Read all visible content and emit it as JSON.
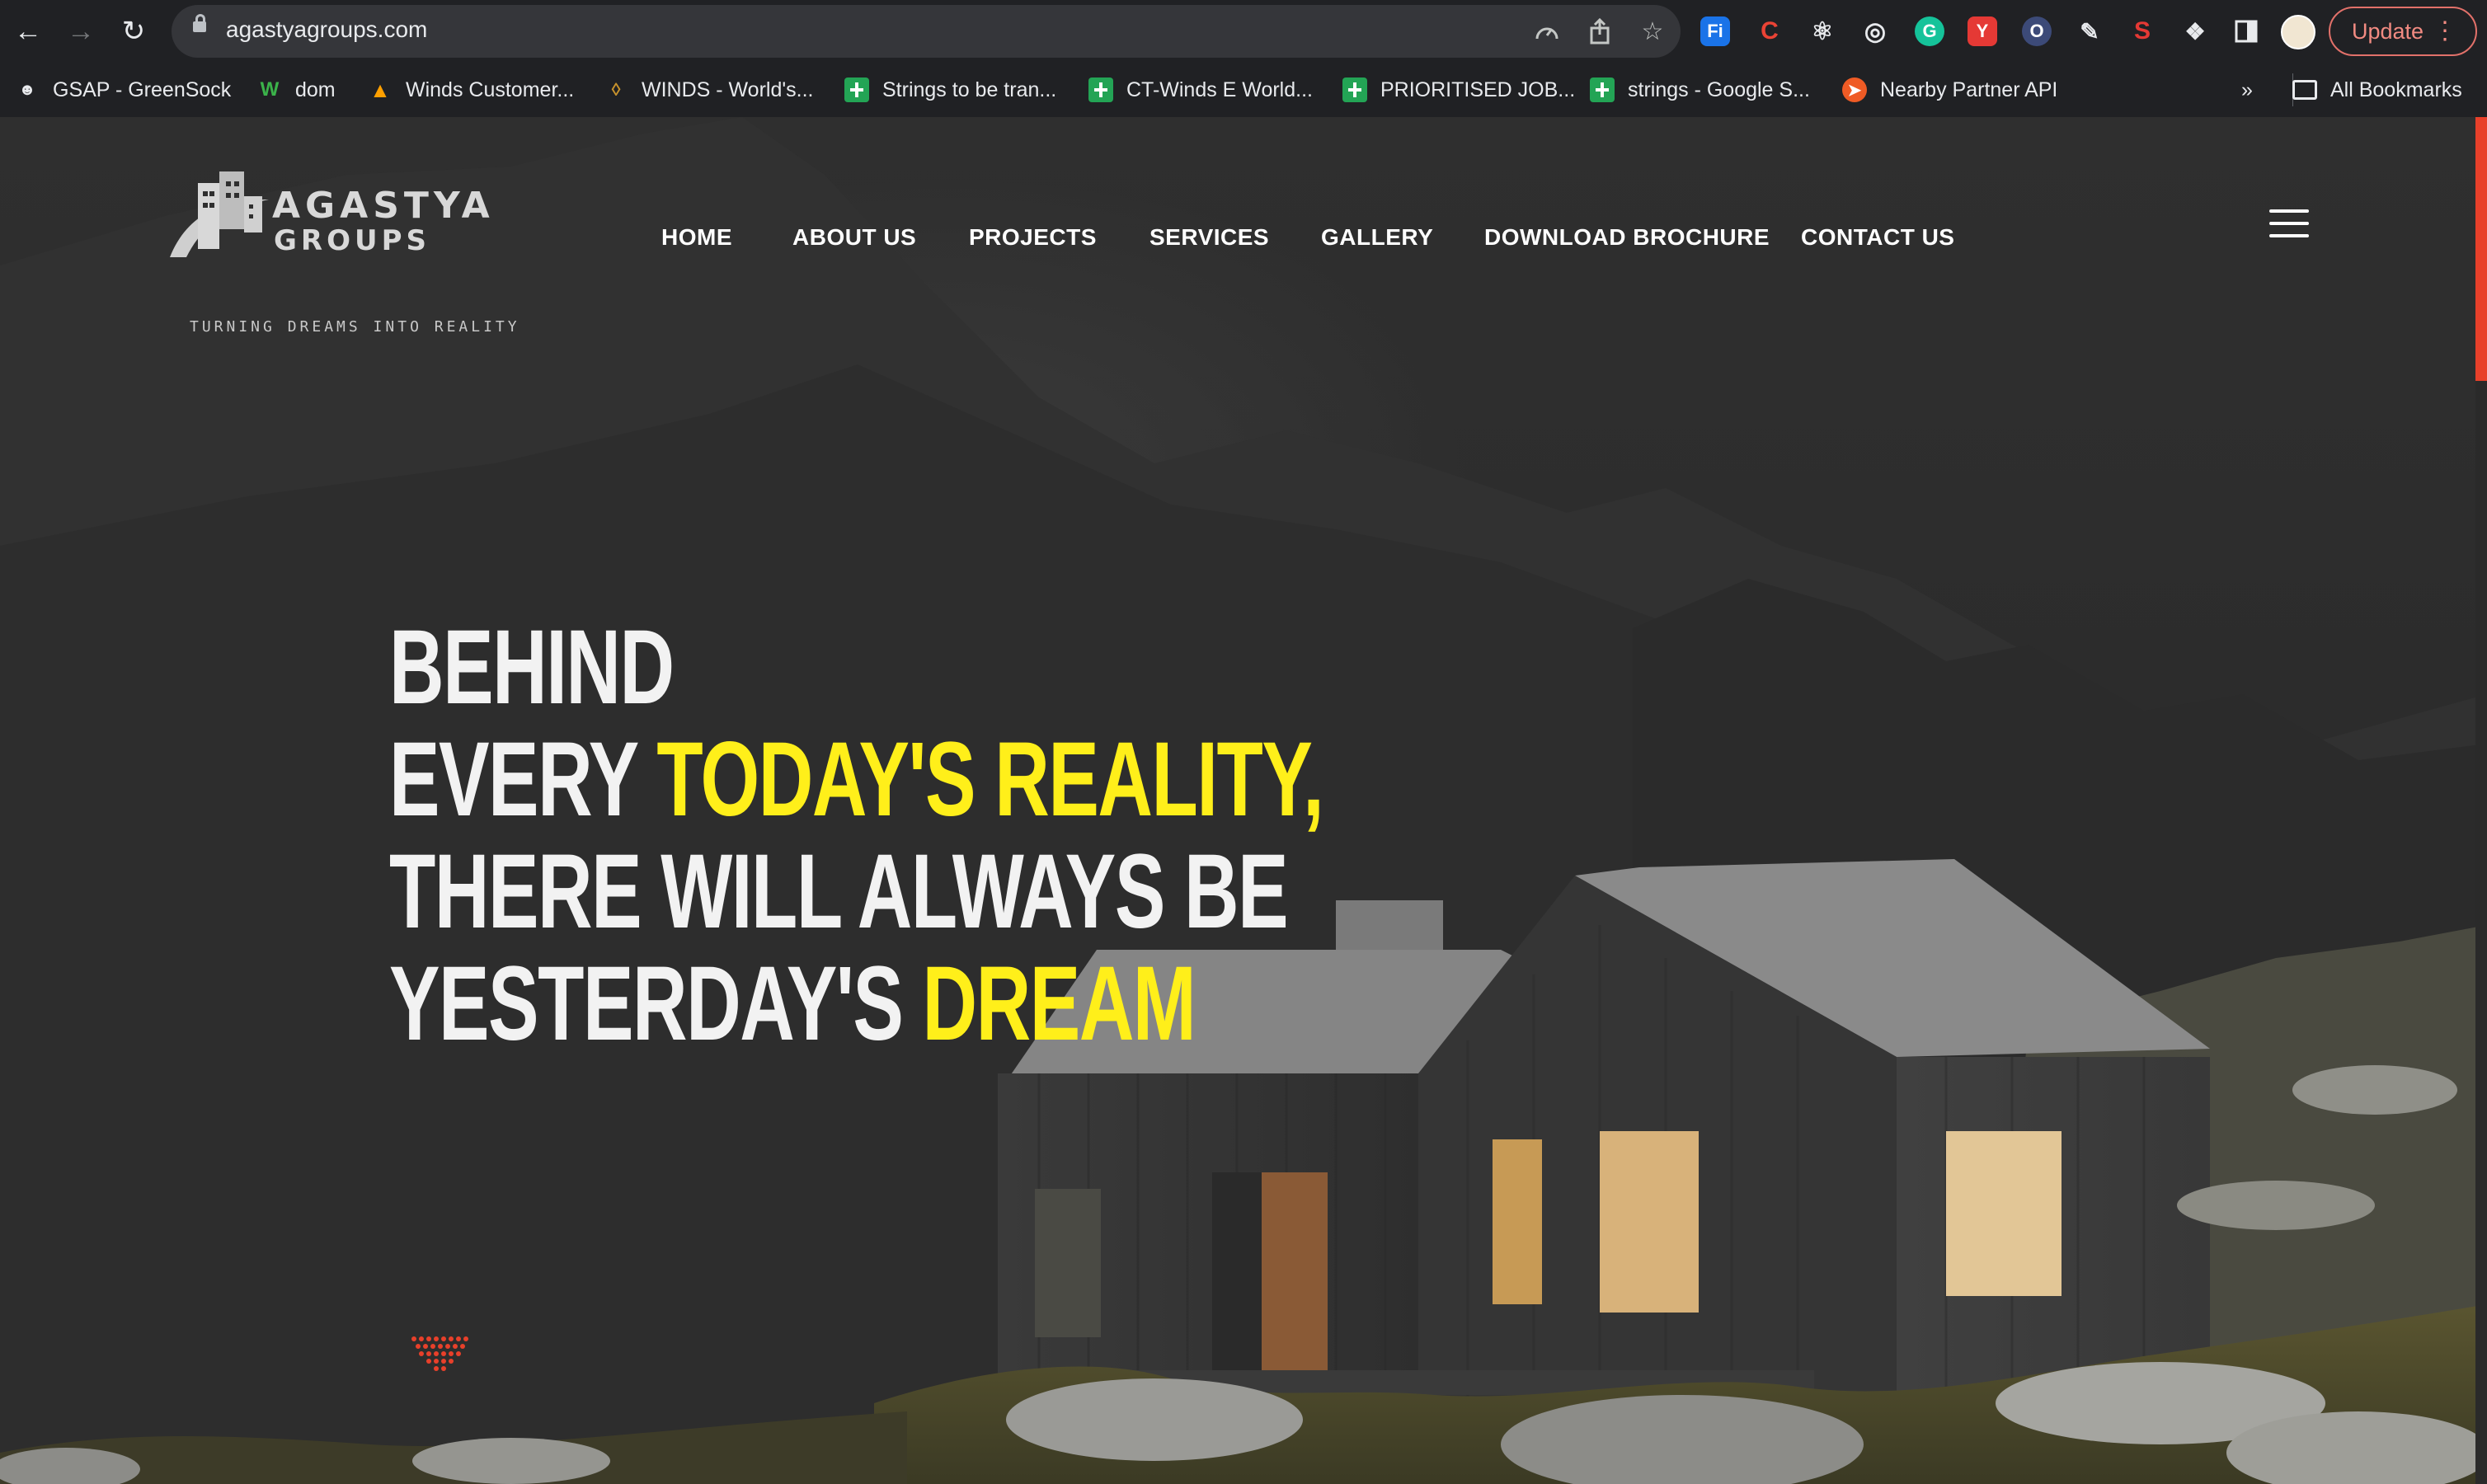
{
  "browser": {
    "url": "agastyagroups.com",
    "update_label": "Update",
    "bookmarks": [
      {
        "label": "GSAP - GreenSock",
        "icon": "greensock-icon"
      },
      {
        "label": "dom",
        "icon": "webflow-icon"
      },
      {
        "label": "Winds Customer...",
        "icon": "firebase-icon"
      },
      {
        "label": "WINDS - World's...",
        "icon": "winds-icon"
      },
      {
        "label": "Strings to be tran...",
        "icon": "sheets-icon"
      },
      {
        "label": "CT-Winds E World...",
        "icon": "sheets-icon"
      },
      {
        "label": "PRIORITISED JOB...",
        "icon": "sheets-icon"
      },
      {
        "label": "strings - Google S...",
        "icon": "sheets-icon"
      },
      {
        "label": "Nearby Partner API",
        "icon": "postman-icon"
      }
    ],
    "overflow_label": "»",
    "all_bookmarks_label": "All Bookmarks"
  },
  "site": {
    "logo": {
      "line1": "AGASTYA",
      "line2": "GROUPS",
      "tagline": "TURNING DREAMS INTO REALITY"
    },
    "nav": [
      "HOME",
      "ABOUT US",
      "PROJECTS",
      "SERVICES",
      "GALLERY",
      "DOWNLOAD BROCHURE",
      "CONTACT US"
    ],
    "hero": {
      "line1": "BEHIND",
      "line2_a": "EVERY ",
      "line2_b": "TODAY'S REALITY,",
      "line3": "THERE WILL ALWAYS BE",
      "line4_a": "YESTERDAY'S ",
      "line4_b": "DREAM"
    }
  },
  "colors": {
    "accent_yellow": "#ffef1a",
    "accent_red": "#e8402a",
    "background": "#2a2a2a",
    "chrome": "#202124"
  }
}
